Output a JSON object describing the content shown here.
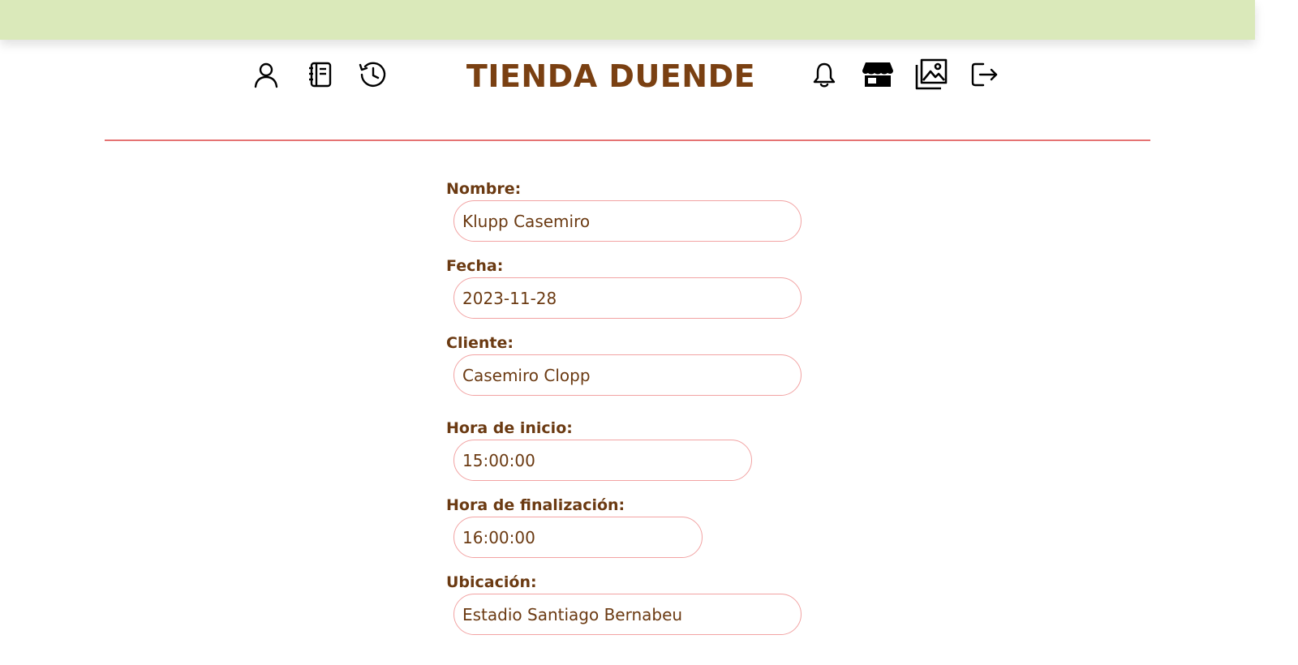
{
  "header": {
    "title": "TIENDA DUENDE",
    "left_icons": [
      "user-icon",
      "notebook-icon",
      "history-icon"
    ],
    "right_icons": [
      "bell-icon",
      "store-icon",
      "gallery-icon",
      "logout-icon"
    ]
  },
  "form": {
    "nombre": {
      "label": "Nombre:",
      "value": "Klupp Casemiro"
    },
    "fecha": {
      "label": "Fecha:",
      "value": "2023-11-28"
    },
    "cliente": {
      "label": "Cliente:",
      "value": "Casemiro Clopp"
    },
    "hora_inicio": {
      "label": "Hora de inicio:",
      "value": "15:00:00"
    },
    "hora_fin": {
      "label": "Hora de finalización:",
      "value": "16:00:00"
    },
    "ubicacion": {
      "label": "Ubicación:",
      "value": "Estadio Santiago Bernabeu"
    }
  },
  "colors": {
    "topbar": "#dae9ba",
    "title": "#7a4012",
    "label": "#6b3a12",
    "divider": "#e57373",
    "input_border": "#f2a3a3"
  }
}
